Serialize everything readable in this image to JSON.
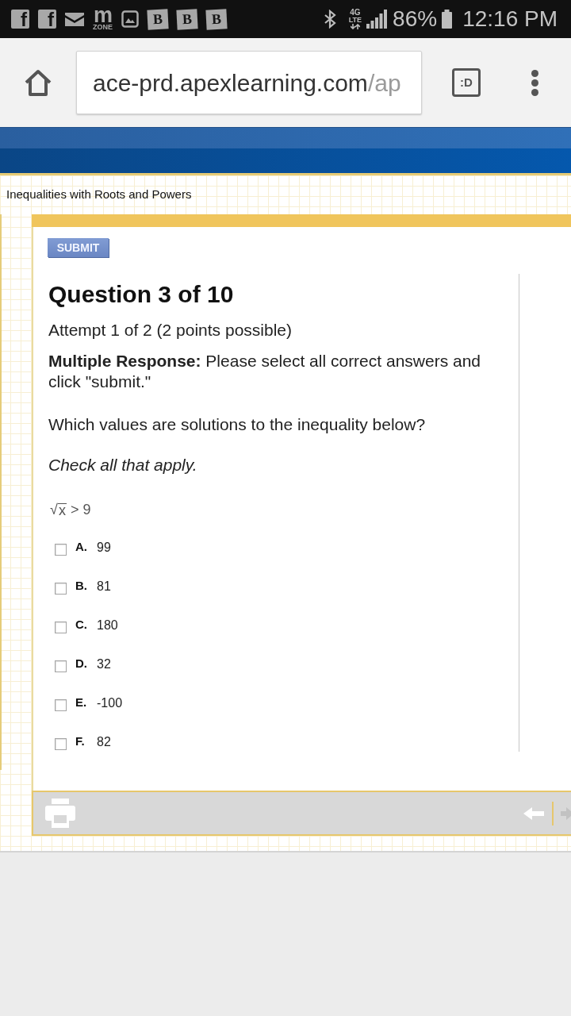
{
  "status_bar": {
    "notifications": [
      {
        "kind": "letter_tile",
        "glyph": "f"
      },
      {
        "kind": "letter_tile",
        "glyph": "f"
      },
      {
        "kind": "mail"
      },
      {
        "kind": "logo",
        "glyph": "m",
        "caption": "ZONE"
      },
      {
        "kind": "photo"
      },
      {
        "kind": "slanted_tile",
        "glyph": "B"
      },
      {
        "kind": "slanted_tile",
        "glyph": "B"
      },
      {
        "kind": "slanted_tile",
        "glyph": "B"
      }
    ],
    "network": {
      "generation": "4G",
      "type": "LTE"
    },
    "battery": "86%",
    "time": "12:16 PM"
  },
  "browser": {
    "url": {
      "host": "ace-prd.apexlearning.com",
      "path": "/ap"
    },
    "tabs_button": ":D"
  },
  "lesson": {
    "title": "Inequalities with Roots and Powers",
    "submit_button": "SUBMIT",
    "question": {
      "title": "Question 3 of 10",
      "attempt": "Attempt 1 of 2 (2 points possible)",
      "instructions": "**Multiple Response:** Please select all correct answers and click \"submit.\"",
      "prompt": "Which values are solutions to the inequality below?",
      "hint": "Check all that apply.",
      "inequality": {
        "radical": "√",
        "radicand": "x",
        "comparison": "> 9"
      },
      "options": [
        {
          "letter": "A.",
          "value": "99",
          "checked": false
        },
        {
          "letter": "B.",
          "value": "81",
          "checked": false
        },
        {
          "letter": "C.",
          "value": "180",
          "checked": false
        },
        {
          "letter": "D.",
          "value": "32",
          "checked": false
        },
        {
          "letter": "E.",
          "value": "-100",
          "checked": false
        },
        {
          "letter": "F.",
          "value": "82",
          "checked": false
        }
      ]
    }
  }
}
